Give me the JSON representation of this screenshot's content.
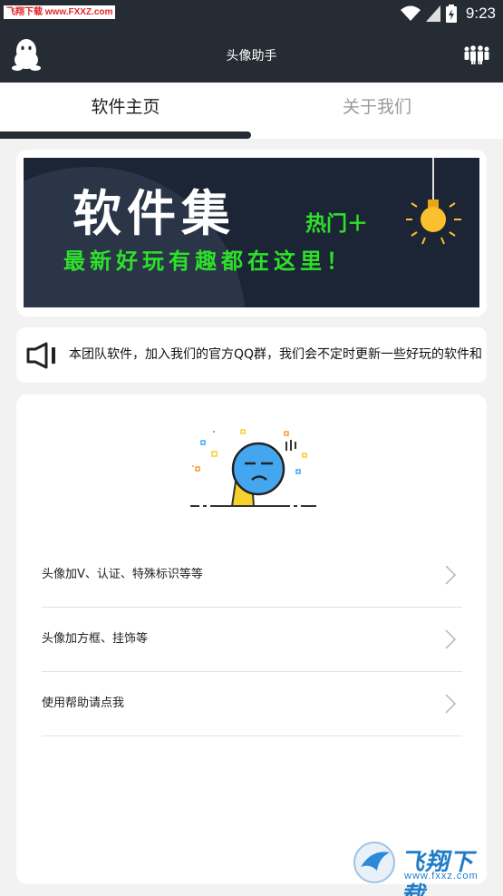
{
  "status_bar": {
    "watermark": "飞翔下载 www.FXXZ.com",
    "time": "9:23"
  },
  "app_bar": {
    "title": "头像助手",
    "left_icon": "qq-penguin-icon",
    "right_icon": "group-icon"
  },
  "tabs": [
    {
      "label": "软件主页",
      "active": true
    },
    {
      "label": "关于我们",
      "active": false
    }
  ],
  "banner": {
    "title": "软件集",
    "hot": "热门＋",
    "subtitle": "最新好玩有趣都在这里！"
  },
  "notice": {
    "icon": "speaker-icon",
    "text": "本团队软件，加入我们的官方QQ群，我们会不定时更新一些好玩的软件和"
  },
  "list": {
    "items": [
      {
        "label": "头像加V、认证、特殊标识等等"
      },
      {
        "label": "头像加方框、挂饰等"
      },
      {
        "label": "使用帮助请点我"
      }
    ]
  },
  "watermark": {
    "logo_text": "飞翔下载",
    "url": "www.fxxz.com"
  },
  "colors": {
    "bar": "#262c33",
    "banner_bg": "#1b2535",
    "banner_green": "#2ee02a",
    "mascot_blue": "#45a6f0",
    "mascot_yellow": "#f7cf2e"
  }
}
